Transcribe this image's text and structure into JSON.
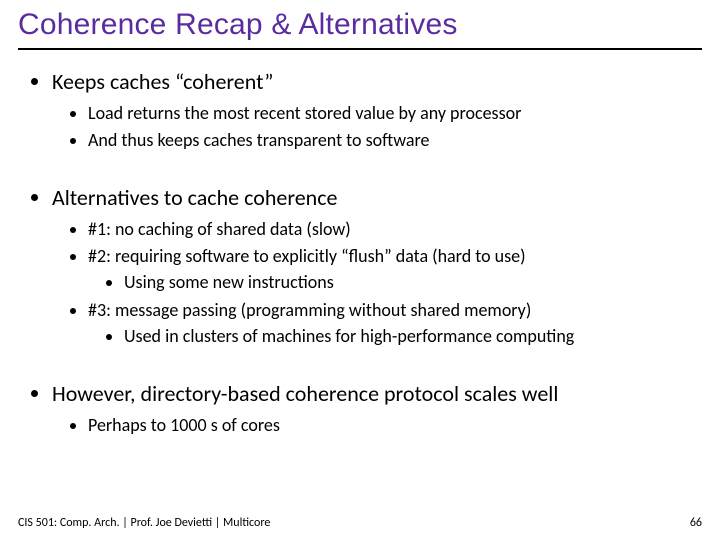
{
  "title": "Coherence Recap & Alternatives",
  "points": {
    "p1": "Keeps caches “coherent”",
    "p1a": "Load returns the most recent stored value by any processor",
    "p1b": "And thus keeps caches transparent to software",
    "p2": "Alternatives to cache coherence",
    "p2a": "#1: no caching of shared data (slow)",
    "p2b": "#2: requiring software to explicitly “flush” data (hard to use)",
    "p2b1": "Using some new instructions",
    "p2c": "#3: message passing (programming without shared memory)",
    "p2c1": "Used in clusters of machines for high-performance computing",
    "p3": "However, directory-based coherence protocol scales well",
    "p3a": "Perhaps to 1000 s of cores"
  },
  "footer": {
    "left": "CIS 501: Comp. Arch.  |  Prof. Joe Devietti  |  Multicore",
    "pagenum": "66"
  }
}
